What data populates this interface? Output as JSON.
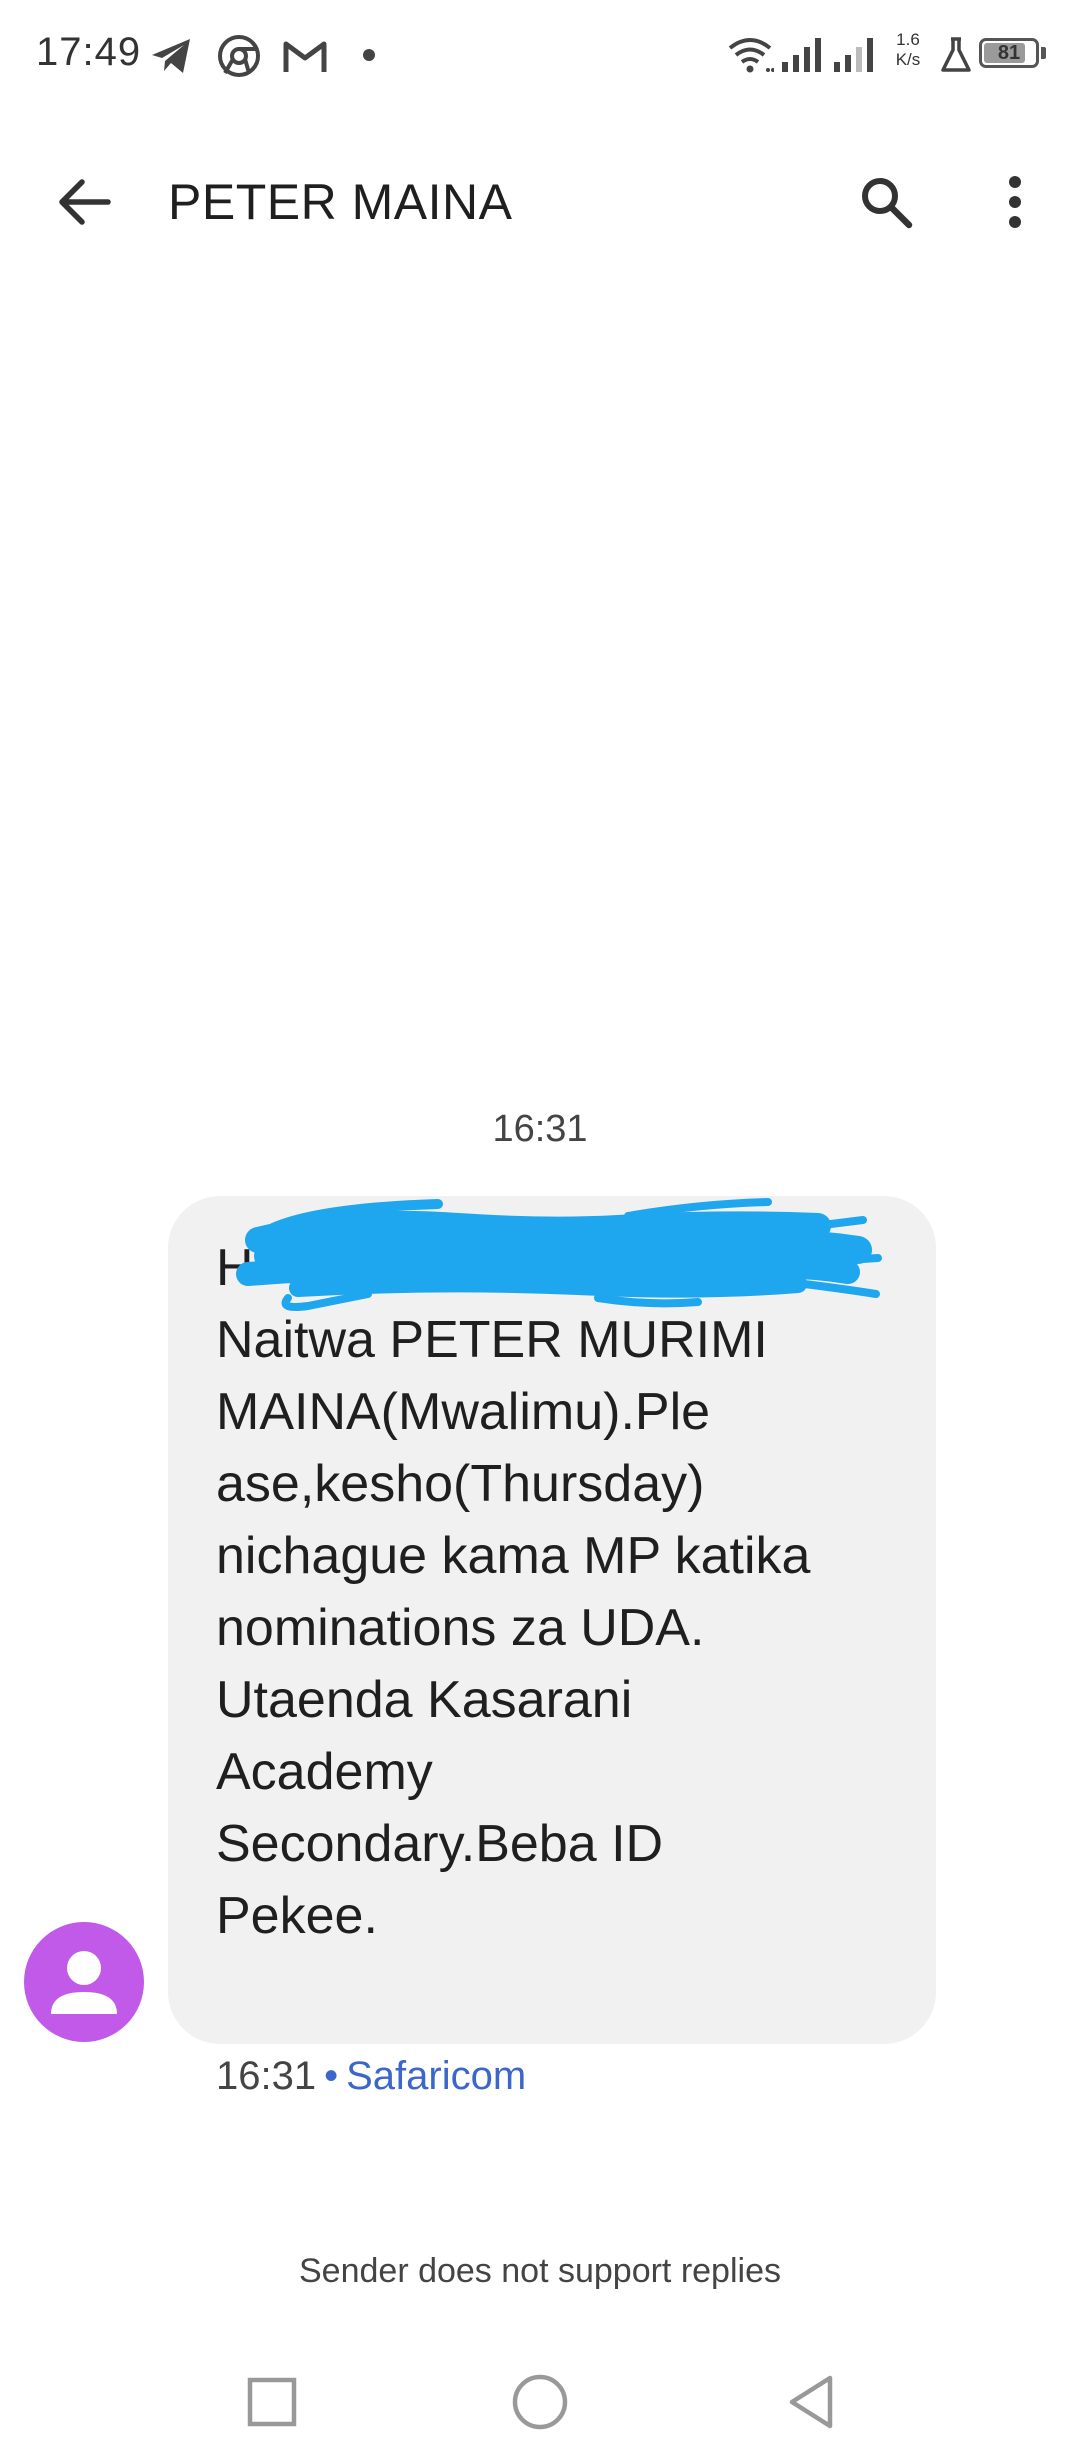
{
  "status_bar": {
    "time": "17:49",
    "net_speed_value": "1.6",
    "net_speed_unit": "K/s",
    "battery": "81",
    "battery_level": 0.81,
    "icons": [
      "telegram-icon",
      "chrome-icon",
      "gmail-icon",
      "notification-dot-icon",
      "wifi-icon",
      "signal-icon",
      "signal-icon",
      "lab-icon",
      "battery-icon"
    ]
  },
  "app_bar": {
    "title": "PETER MAINA",
    "back_icon": "arrow-back-icon",
    "search_icon": "search-icon",
    "menu_icon": "more-vert-icon"
  },
  "conversation": {
    "time_divider": "16:31",
    "message": {
      "lines": [
        "Hi",
        "Naitwa PETER MURIMI",
        "MAINA(Mwalimu).Ple",
        "ase,kesho(Thursday)",
        "nichague kama MP katika",
        "nominations za UDA.",
        "",
        "Utaenda Kasarani",
        "Academy",
        "Secondary.Beba ID",
        "Pekee."
      ],
      "redaction_color": "#1ea7ee"
    },
    "meta": {
      "time": "16:31",
      "separator": "•",
      "carrier": "Safaricom"
    },
    "avatar_color": "#c15ae8",
    "avatar_icon": "person-icon"
  },
  "footer": {
    "no_reply_notice": "Sender does not support replies"
  },
  "nav_bar": {
    "recents_icon": "square-icon",
    "home_icon": "circle-icon",
    "back_icon": "triangle-back-icon"
  },
  "colors": {
    "bubble": "#f1f1f1",
    "link": "#3b67c9",
    "avatar": "#c15ae8"
  }
}
